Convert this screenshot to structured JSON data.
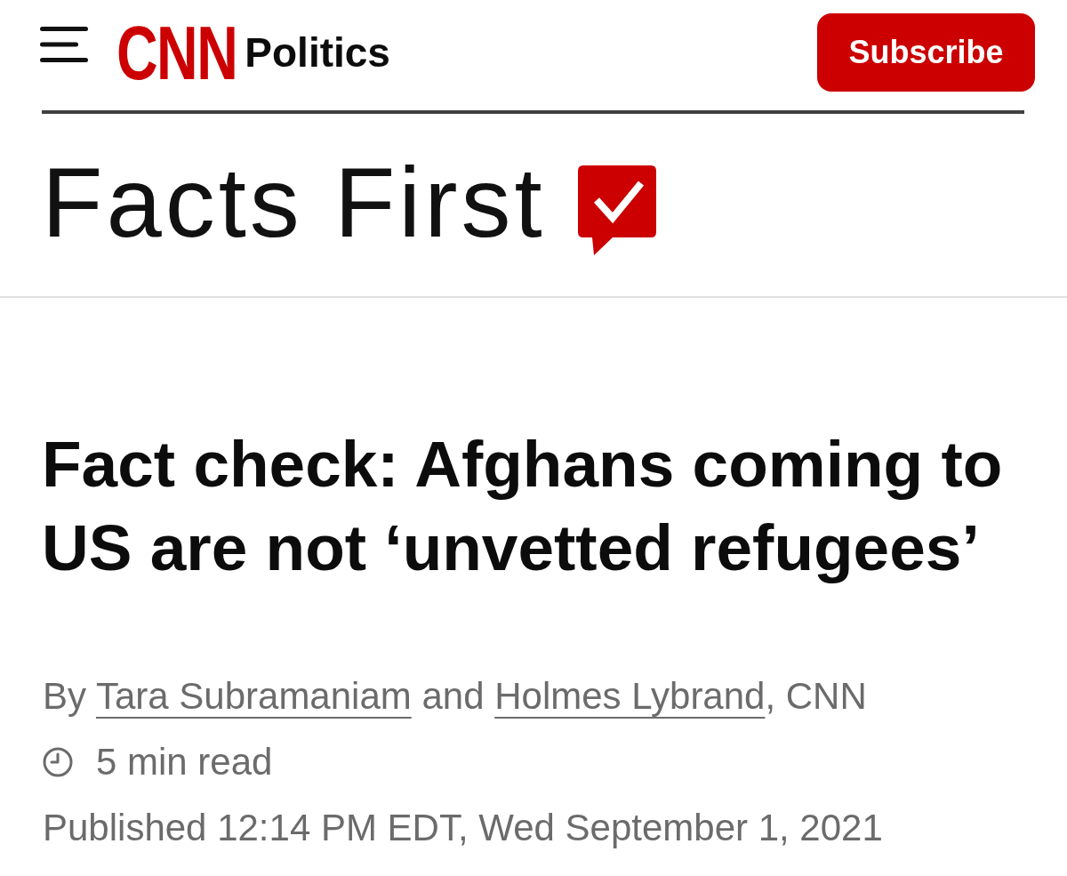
{
  "header": {
    "logo": "CNN",
    "section": "Politics",
    "subscribe_label": "Subscribe"
  },
  "banner": {
    "title": "Facts First"
  },
  "article": {
    "headline": "Fact check: Afghans coming to US are not ‘unvetted refugees’",
    "byline": [
      {
        "kind": "text",
        "text": "By "
      },
      {
        "kind": "link",
        "text": "Tara Subramaniam"
      },
      {
        "kind": "text",
        "text": " and "
      },
      {
        "kind": "link",
        "text": "Holmes Lybrand"
      },
      {
        "kind": "text",
        "text": ", CNN"
      }
    ],
    "read_time": "5 min read",
    "published": "Published 12:14 PM EDT, Wed September 1, 2021"
  }
}
